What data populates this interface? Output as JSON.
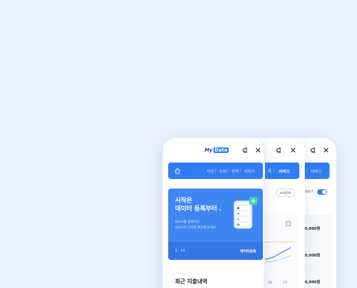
{
  "front": {
    "logo": {
      "my": "My",
      "data": "Data"
    },
    "nav": [
      "자산",
      "소비",
      "등록",
      "서비스"
    ],
    "hero": {
      "title_line1": "시작은",
      "title_line2": "데이터 등록부터 .",
      "desc_line1": "데이터를 등록하고,",
      "desc_line2": "내자산의 가치를 확인해 보세요.",
      "page": "1 : 10",
      "action": "데이터등록"
    },
    "section_title": "최근 지출내역"
  },
  "back1": {
    "nav_active": "서비스",
    "nav_label_short": "록",
    "chip": "소비분석",
    "chart_labels": [
      "3월",
      "3/4"
    ]
  },
  "back2": {
    "nav_label": "서비스",
    "toggle_label": "금액보기",
    "amounts": [
      "00,000원",
      "00,000원",
      "00,000원"
    ]
  },
  "colors": {
    "accent": "#2f7cf6",
    "background": "#e9f1fd"
  }
}
